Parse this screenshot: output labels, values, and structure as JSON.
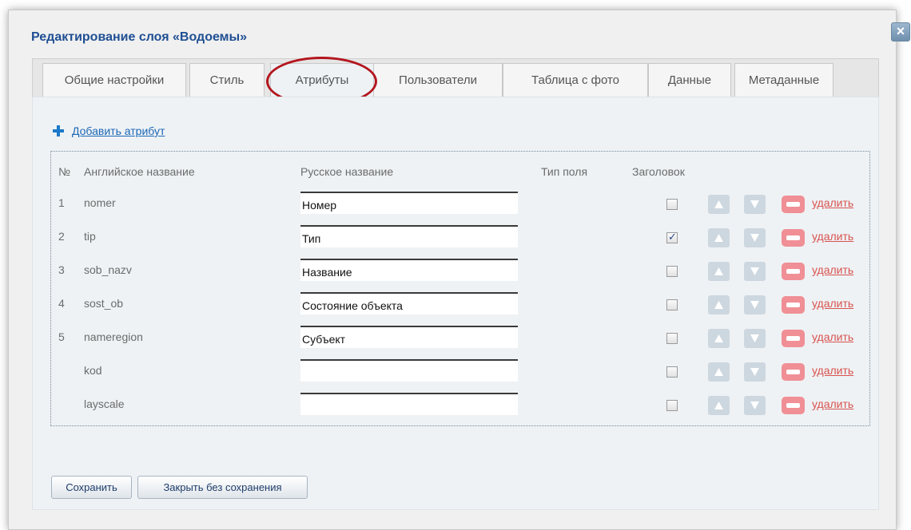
{
  "dialog": {
    "title": "Редактирование слоя «Водоемы»",
    "close_icon": "close-icon"
  },
  "tabs": [
    {
      "label": "Общие настройки"
    },
    {
      "label": "Стиль"
    },
    {
      "label": "Атрибуты",
      "active": true
    },
    {
      "label": "Пользователи"
    },
    {
      "label": "Таблица с фото"
    },
    {
      "label": "Данные"
    },
    {
      "label": "Метаданные"
    }
  ],
  "add_attribute": {
    "label": "Добавить атрибут",
    "icon": "plus-icon"
  },
  "table": {
    "headers": {
      "num": "№",
      "en": "Английское название",
      "ru": "Русское название",
      "type": "Тип поля",
      "caption": "Заголовок"
    },
    "rows": [
      {
        "num": "1",
        "en": "nomer",
        "ru": "Номер",
        "caption": false,
        "delete": "удалить"
      },
      {
        "num": "2",
        "en": "tip",
        "ru": "Тип",
        "caption": true,
        "delete": "удалить"
      },
      {
        "num": "3",
        "en": "sob_nazv",
        "ru": "Название",
        "caption": false,
        "delete": "удалить"
      },
      {
        "num": "4",
        "en": "sost_ob",
        "ru": "Состояние объекта",
        "caption": false,
        "delete": "удалить"
      },
      {
        "num": "5",
        "en": "nameregion",
        "ru": "Субъект",
        "caption": false,
        "delete": "удалить"
      },
      {
        "num": "",
        "en": "kod",
        "ru": "",
        "caption": false,
        "delete": "удалить"
      },
      {
        "num": "",
        "en": "layscale",
        "ru": "",
        "caption": false,
        "delete": "удалить"
      }
    ]
  },
  "footer": {
    "save": "Сохранить",
    "close_no_save": "Закрыть без сохранения"
  },
  "colors": {
    "title": "#1f4f93",
    "link": "#1c67b5",
    "delete": "#d9534f",
    "highlight_ring": "#b3161e"
  }
}
